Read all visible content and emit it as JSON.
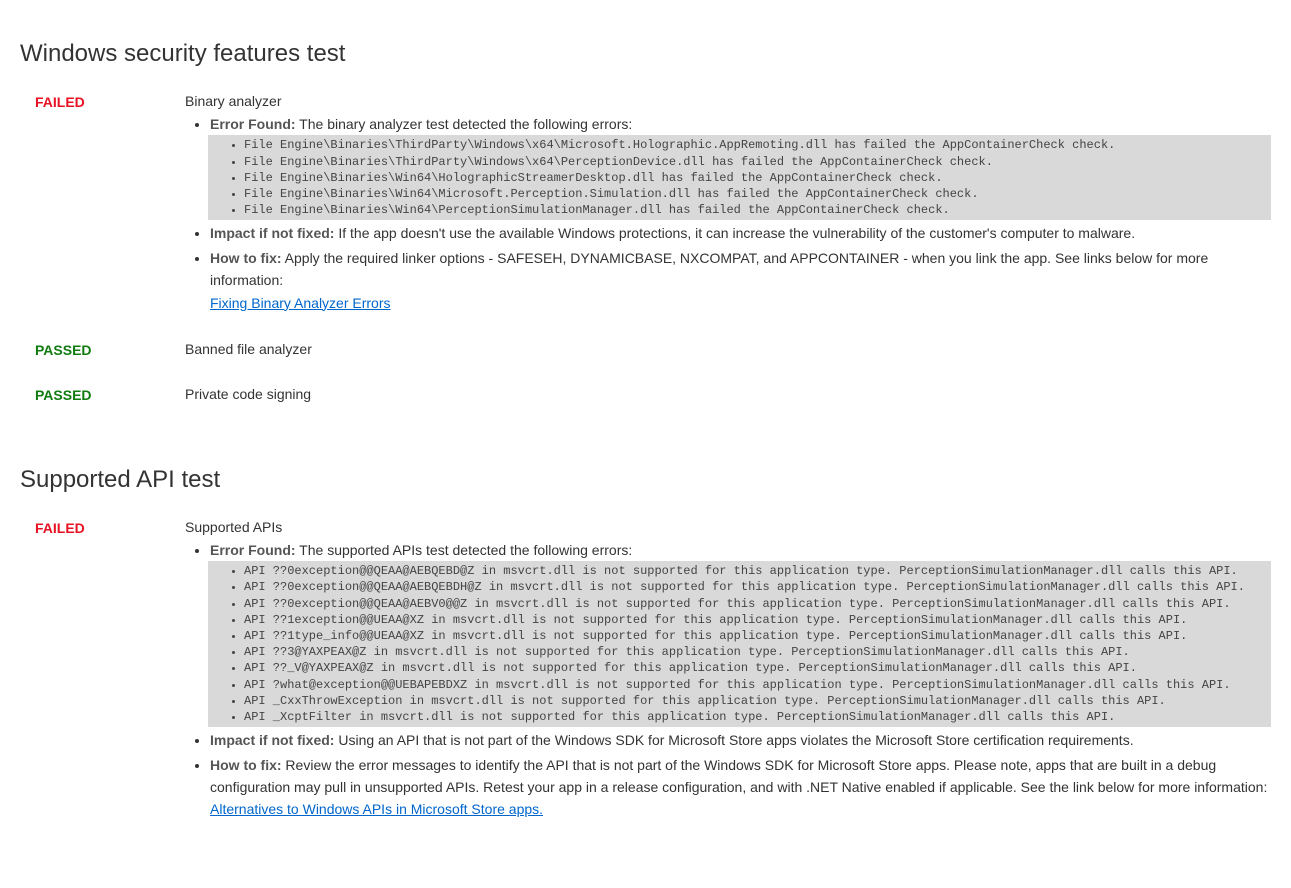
{
  "sections": [
    {
      "title": "Windows security features test",
      "tests": [
        {
          "status": "FAILED",
          "name": "Binary analyzer",
          "error_found_label": "Error Found:",
          "error_found_text": " The binary analyzer test detected the following errors:",
          "error_lines": [
            "File Engine\\Binaries\\ThirdParty\\Windows\\x64\\Microsoft.Holographic.AppRemoting.dll has failed the AppContainerCheck check.",
            "File Engine\\Binaries\\ThirdParty\\Windows\\x64\\PerceptionDevice.dll has failed the AppContainerCheck check.",
            "File Engine\\Binaries\\Win64\\HolographicStreamerDesktop.dll has failed the AppContainerCheck check.",
            "File Engine\\Binaries\\Win64\\Microsoft.Perception.Simulation.dll has failed the AppContainerCheck check.",
            "File Engine\\Binaries\\Win64\\PerceptionSimulationManager.dll has failed the AppContainerCheck check."
          ],
          "impact_label": "Impact if not fixed:",
          "impact_text": " If the app doesn't use the available Windows protections, it can increase the vulnerability of the customer's computer to malware.",
          "fix_label": "How to fix:",
          "fix_text": " Apply the required linker options - SAFESEH, DYNAMICBASE, NXCOMPAT, and APPCONTAINER - when you link the app. See links below for more information: ",
          "fix_link": "Fixing Binary Analyzer Errors"
        },
        {
          "status": "PASSED",
          "name": "Banned file analyzer"
        },
        {
          "status": "PASSED",
          "name": "Private code signing"
        }
      ]
    },
    {
      "title": "Supported API test",
      "tests": [
        {
          "status": "FAILED",
          "name": "Supported APIs",
          "error_found_label": "Error Found:",
          "error_found_text": " The supported APIs test detected the following errors:",
          "error_lines": [
            "API ??0exception@@QEAA@AEBQEBD@Z in msvcrt.dll is not supported for this application type. PerceptionSimulationManager.dll calls this API.",
            "API ??0exception@@QEAA@AEBQEBDH@Z in msvcrt.dll is not supported for this application type. PerceptionSimulationManager.dll calls this API.",
            "API ??0exception@@QEAA@AEBV0@@Z in msvcrt.dll is not supported for this application type. PerceptionSimulationManager.dll calls this API.",
            "API ??1exception@@UEAA@XZ in msvcrt.dll is not supported for this application type. PerceptionSimulationManager.dll calls this API.",
            "API ??1type_info@@UEAA@XZ in msvcrt.dll is not supported for this application type. PerceptionSimulationManager.dll calls this API.",
            "API ??3@YAXPEAX@Z in msvcrt.dll is not supported for this application type. PerceptionSimulationManager.dll calls this API.",
            "API ??_V@YAXPEAX@Z in msvcrt.dll is not supported for this application type. PerceptionSimulationManager.dll calls this API.",
            "API ?what@exception@@UEBAPEBDXZ in msvcrt.dll is not supported for this application type. PerceptionSimulationManager.dll calls this API.",
            "API _CxxThrowException in msvcrt.dll is not supported for this application type. PerceptionSimulationManager.dll calls this API.",
            "API _XcptFilter in msvcrt.dll is not supported for this application type. PerceptionSimulationManager.dll calls this API."
          ],
          "impact_label": "Impact if not fixed:",
          "impact_text": " Using an API that is not part of the Windows SDK for Microsoft Store apps violates the Microsoft Store certification requirements.",
          "fix_label": "How to fix:",
          "fix_text": " Review the error messages to identify the API that is not part of the Windows SDK for Microsoft Store apps. Please note, apps that are built in a debug configuration may pull in unsupported APIs. Retest your app in a release configuration, and with .NET Native enabled if applicable. See the link below for more information: ",
          "fix_link": "Alternatives to Windows APIs in Microsoft Store apps."
        }
      ]
    }
  ]
}
